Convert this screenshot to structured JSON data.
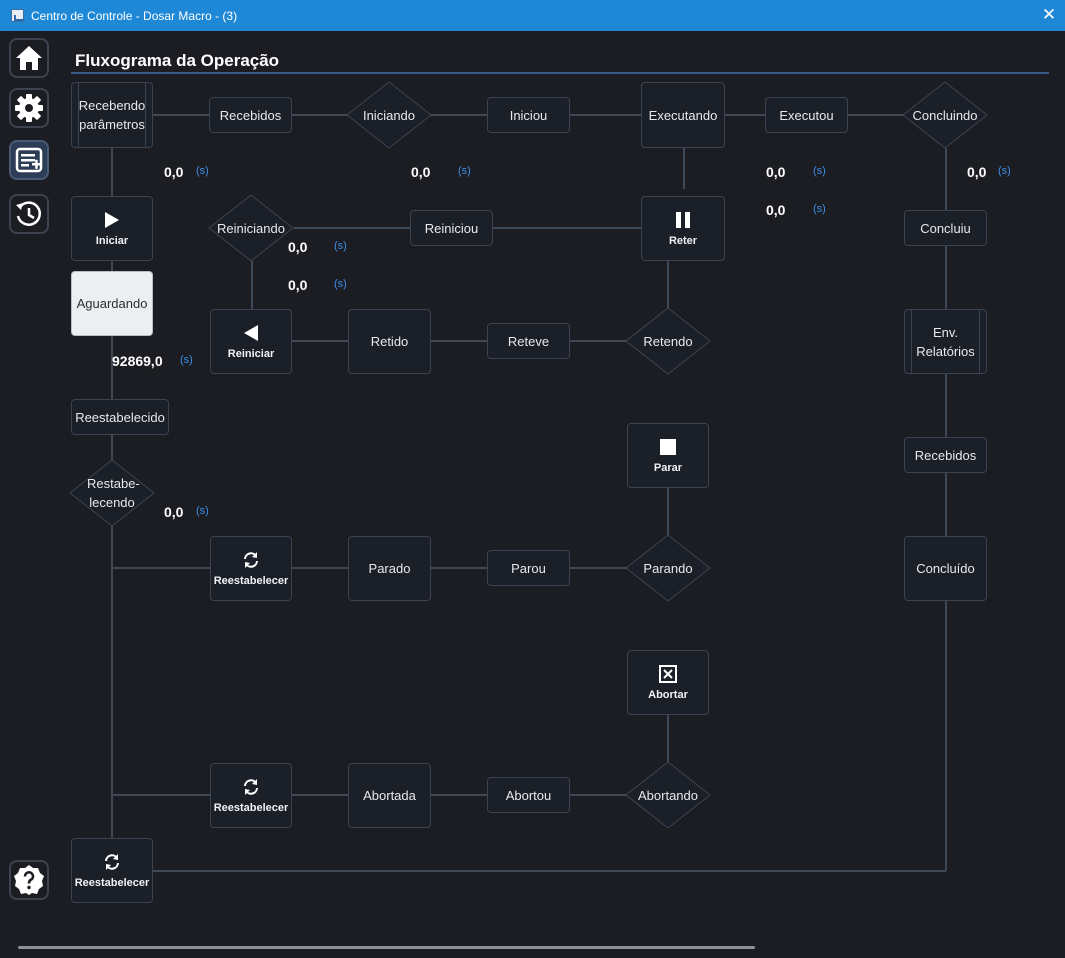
{
  "window": {
    "title": "Centro de Controle - Dosar Macro -  (3)",
    "close_glyph": "✕"
  },
  "sidebar": {
    "items": [
      {
        "icon": "home-icon"
      },
      {
        "icon": "gear-icon"
      },
      {
        "icon": "list-add-icon",
        "active": true
      },
      {
        "icon": "history-icon"
      },
      {
        "icon": "help-icon"
      }
    ]
  },
  "heading": "Fluxograma da Operação",
  "nodes": {
    "recebendo": "Recebendo parâmetros",
    "recebidos_top": "Recebidos",
    "iniciando": "Iniciando",
    "iniciou": "Iniciou",
    "executando": "Executando",
    "executou": "Executou",
    "concluindo": "Concluindo",
    "iniciar": "Iniciar",
    "reiniciando": "Reiniciando",
    "reiniciou": "Reiniciou",
    "reter": "Reter",
    "concluiu": "Concluiu",
    "aguardando": "Aguardando",
    "reiniciar": "Reiniciar",
    "retido": "Retido",
    "reteve": "Reteve",
    "retendo": "Retendo",
    "env_relatorios": "Env. Relatórios",
    "reestabelecido": "Reestabelecido",
    "recebidos_right": "Recebidos",
    "parar": "Parar",
    "restabelecendo": "Restabe- lecendo",
    "reestabelecer_1": "Reestabelecer",
    "parado": "Parado",
    "parou": "Parou",
    "parando": "Parando",
    "concluido": "Concluído",
    "abortar": "Abortar",
    "reestabelecer_2": "Reestabelecer",
    "abortada": "Abortada",
    "abortou": "Abortou",
    "abortando": "Abortando",
    "reestabelecer_3": "Reestabelecer"
  },
  "timers": {
    "recebendo": "0,0",
    "iniciando": "0,0",
    "executando": "0,0",
    "executando_2": "0,0",
    "concluindo": "0,0",
    "reiniciando": "0,0",
    "reiniciando_2": "0,0",
    "aguardando": "92869,0",
    "restabelecendo": "0,0",
    "unit": "(s)"
  },
  "colors": {
    "titlebar": "#1e88d6",
    "background": "#1b1d22",
    "node_border": "#3c4350",
    "connector": "#3e4857",
    "unit": "#3d8ee8",
    "active_node": "#eceef1"
  }
}
